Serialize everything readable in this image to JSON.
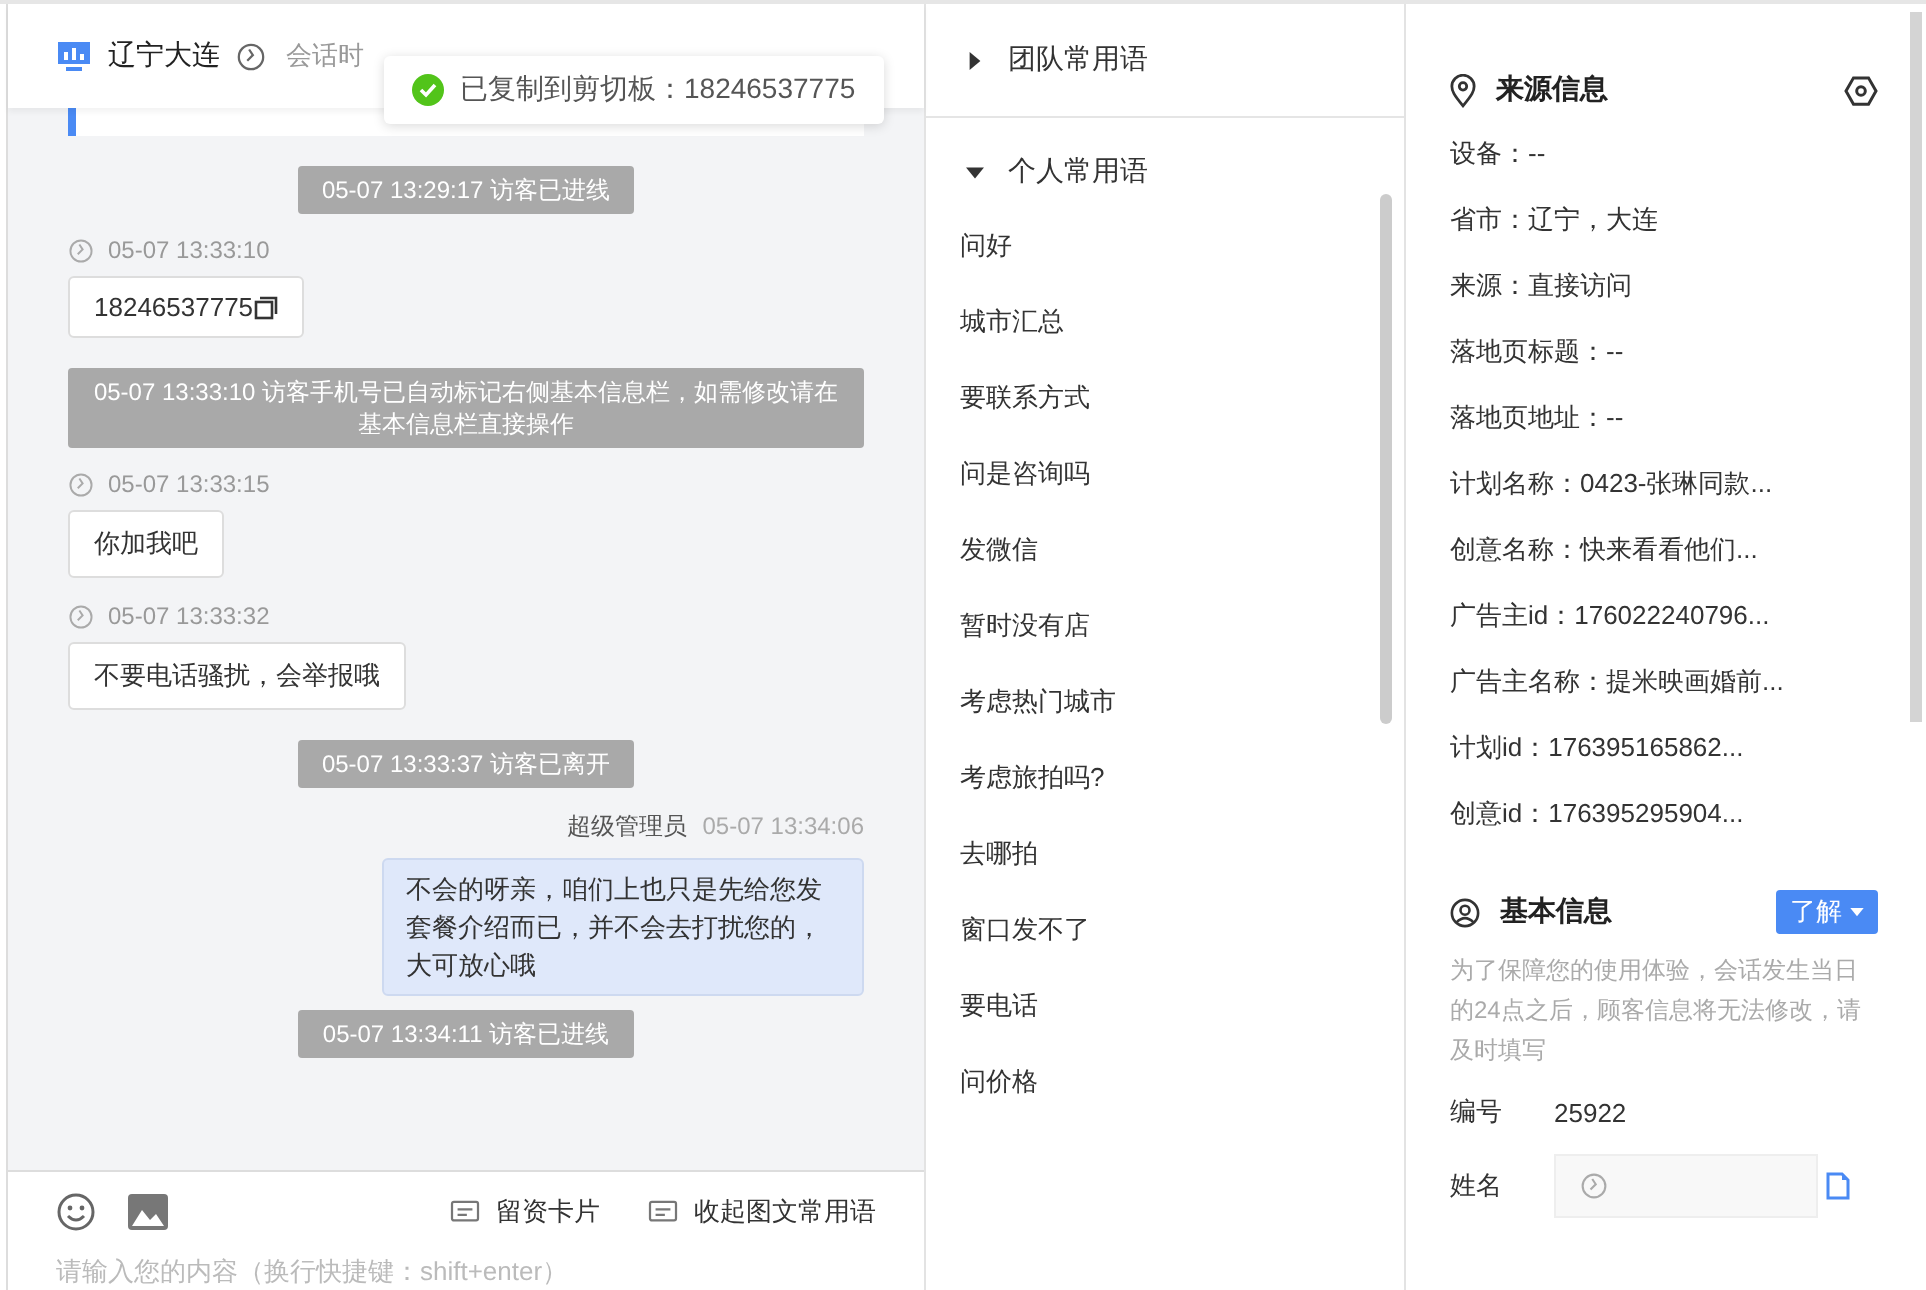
{
  "header": {
    "location": "辽宁大连",
    "session_time": "会话时"
  },
  "toast": {
    "text": "已复制到剪切板：18246537775"
  },
  "messages": [
    {
      "kind": "system",
      "text": "05-07 13:29:17 访客已进线"
    },
    {
      "kind": "visitor",
      "time": "05-07 13:33:10",
      "text": "18246537775",
      "copy": true
    },
    {
      "kind": "system",
      "text": "05-07 13:33:10 访客手机号已自动标记右侧基本信息栏，如需修改请在基本信息栏直接操作"
    },
    {
      "kind": "visitor",
      "time": "05-07 13:33:15",
      "text": "你加我吧",
      "copy": false
    },
    {
      "kind": "visitor",
      "time": "05-07 13:33:32",
      "text": "不要电话骚扰，会举报哦",
      "copy": false
    },
    {
      "kind": "system",
      "text": "05-07 13:33:37 访客已离开"
    },
    {
      "kind": "agent",
      "sender": "超级管理员",
      "time": "05-07 13:34:06",
      "text": "不会的呀亲，咱们上也只是先给您发套餐介绍而已，并不会去打扰您的，大可放心哦"
    },
    {
      "kind": "system",
      "text": "05-07 13:34:11 访客已进线"
    }
  ],
  "composer": {
    "tools": [
      "留资卡片",
      "收起图文常用语"
    ],
    "placeholder": "请输入您的内容（换行快捷键：shift+enter）"
  },
  "phrases": [
    {
      "title": "团队常用语",
      "expanded": false
    },
    {
      "title": "个人常用语",
      "expanded": true,
      "items": [
        "问好",
        "城市汇总",
        "要联系方式",
        "问是咨询吗",
        "发微信",
        "暂时没有店",
        "考虑热门城市",
        "考虑旅拍吗?",
        "去哪拍",
        "窗口发不了",
        "要电话",
        "问价格"
      ]
    }
  ],
  "source_info": {
    "title": "来源信息",
    "rows": [
      "设备：--",
      "省市：辽宁，大连",
      "来源：直接访问",
      "落地页标题：--",
      "落地页地址：--",
      "计划名称：0423-张琳同款...",
      "创意名称：快来看看他们...",
      "广告主id：176022240796...",
      "广告主名称：提米映画婚前...",
      "计划id：176395165862...",
      "创意id：176395295904..."
    ]
  },
  "basic_info": {
    "title": "基本信息",
    "button": "了解",
    "note": "为了保障您的使用体验，会话发生当日的24点之后，顾客信息将无法修改，请及时填写",
    "fields": [
      {
        "label": "编号",
        "value": "25922",
        "kind": "text"
      },
      {
        "label": "姓名",
        "kind": "input"
      }
    ]
  }
}
